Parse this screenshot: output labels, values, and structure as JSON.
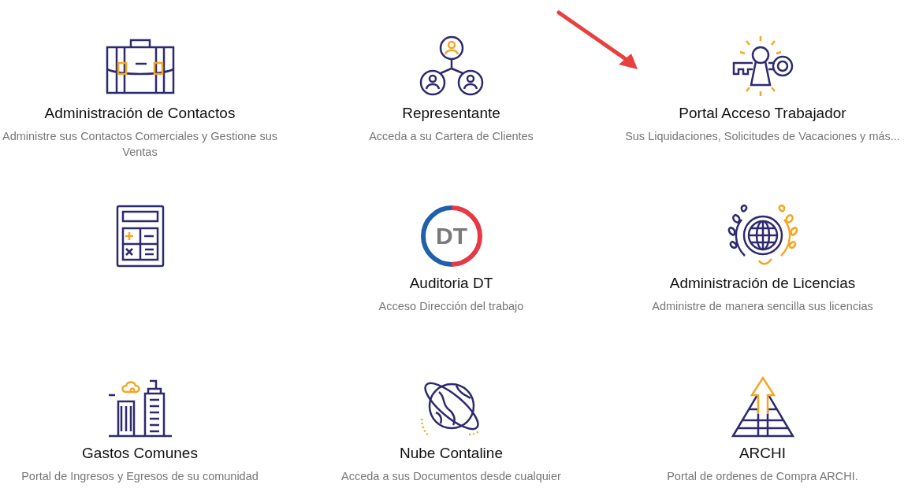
{
  "modules": [
    {
      "kind": "briefcase",
      "title": "Administración de Contactos",
      "description": "Administre sus Contactos Comerciales y Gestione sus Ventas"
    },
    {
      "kind": "people",
      "title": "Representante",
      "description": "Acceda a su Cartera de Clientes"
    },
    {
      "kind": "key",
      "title": "Portal Acceso Trabajador",
      "description": "Sus Liquidaciones, Solicitudes de Vacaciones y más..."
    },
    {
      "kind": "calculator"
    },
    {
      "kind": "dt",
      "title": "Auditoria DT",
      "description": "Acceso Dirección del trabajo",
      "badge": "DT"
    },
    {
      "kind": "globe",
      "title": "Administración de Licencias",
      "description": "Administre de manera sencilla sus licencias"
    },
    {
      "kind": "buildings",
      "title": "Gastos Comunes",
      "description": "Portal de Ingresos y Egresos de su comunidad"
    },
    {
      "kind": "planet",
      "title": "Nube Contaline",
      "description": "Acceda a sus Documentos desde cualquier"
    },
    {
      "kind": "pyramid",
      "title": "ARCHI",
      "description": "Portal de ordenes de Compra ARCHI."
    }
  ]
}
